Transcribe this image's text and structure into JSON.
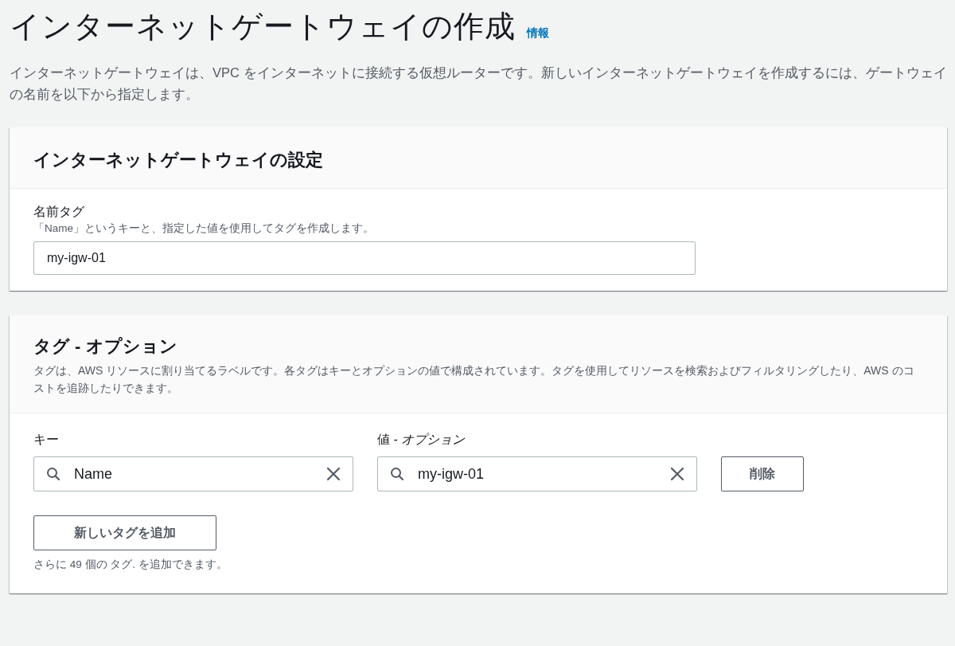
{
  "header": {
    "title": "インターネットゲートウェイの作成",
    "info_link": "情報",
    "description": "インターネットゲートウェイは、VPC をインターネットに接続する仮想ルーターです。新しいインターネットゲートウェイを作成するには、ゲートウェイの名前を以下から指定します。"
  },
  "settings_panel": {
    "title": "インターネットゲートウェイの設定",
    "name_tag": {
      "label": "名前タグ",
      "description": "「Name」というキーと、指定した値を使用してタグを作成します。",
      "value": "my-igw-01"
    }
  },
  "tags_panel": {
    "title": "タグ - オプション",
    "description": "タグは、AWS リソースに割り当てるラベルです。各タグはキーとオプションの値で構成されています。タグを使用してリソースを検索およびフィルタリングしたり、AWS のコストを追跡したりできます。",
    "key_label": "キー",
    "value_label": "値 - *オプション*",
    "tags": [
      {
        "key": "Name",
        "value": "my-igw-01",
        "remove_button": "削除"
      }
    ],
    "add_button": "新しいタグを追加",
    "limit_note": "さらに 49 個の タグ. を追加できます。"
  }
}
